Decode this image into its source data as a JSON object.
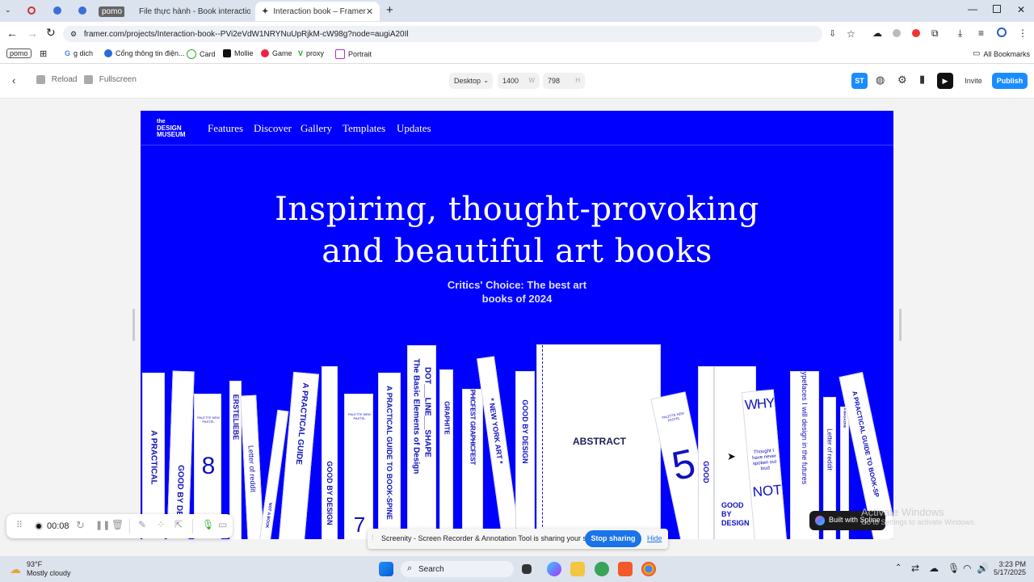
{
  "browser": {
    "tabs": [
      {
        "label": "pomo"
      },
      {
        "label": "File thực hành - Book interactio"
      },
      {
        "label": "Interaction book – Framer"
      }
    ],
    "url": "framer.com/projects/Interaction-book--PVi2eVdW1NRYNuUpRjkM-cW98g?node=augiA20Il",
    "bookmarks": [
      "pomo",
      "g dich",
      "Cổng thông tin điện...",
      "Card",
      "Mollie",
      "Game",
      "proxy",
      "Portrait"
    ],
    "all_bookmarks": "All Bookmarks"
  },
  "framer": {
    "reload": "Reload",
    "fullscreen": "Fullscreen",
    "breakpoint": "Desktop",
    "width": "1400",
    "width_unit": "W",
    "height": "798",
    "height_unit": "H",
    "avatar": "ST",
    "invite": "Invite",
    "publish": "Publish",
    "accent": "#1a8cff"
  },
  "site": {
    "logo": [
      "the",
      "DESIGN",
      "MUSEUM"
    ],
    "nav": [
      "Features",
      "Discover",
      "Gallery",
      "Templates",
      "Updates"
    ],
    "hero_line1": "Inspiring, thought-provoking",
    "hero_line2": "and beautiful art books",
    "sub_line1": "Critics' Choice: The best art",
    "sub_line2": "books of 2024",
    "background": "#0000ff",
    "books": {
      "b1": "A PRACTICAL",
      "b2": "GOOD BY DE",
      "b3_small": "PALETTE NEW PASTEL",
      "b3_num": "8",
      "b4": "ERSTELIEBE",
      "b5": "Letter of reddit",
      "b6": "NOT A BOOK",
      "b7": "A PRACTICAL GUIDE",
      "b8": "GOOD BY DESIGN",
      "b9_small": "PALETTE NEW PASTEL",
      "b9_num": "7",
      "b10": "A PRACTICAL GUIDE TO BOOK-SPINE",
      "b11_a": "DOT___LINE___SHAPE",
      "b11_b": "The Basic Elements of Design",
      "b12": "GRAPHITE",
      "b13": "GRAPHICFEST GRAPHICFEST",
      "b14": "* NEW YORK ART *",
      "b15": "GOOD BY DESIGN",
      "abstract": "ABSTRACT",
      "b17_small": "PALETTE NEW PASTEL",
      "b17_num": "5",
      "b18": "GOOD",
      "b19": "GOOD BY DESIGN",
      "why": "WHY",
      "why_mid": "Thought I have never spoken out loud",
      "not": "NOT",
      "b21": "Typefaces I will design in the futures",
      "b22": "Letter of reddit",
      "b23": "A MAGAZINE",
      "b24": "A PRACTICAL GUIDE TO BOOK-SP"
    }
  },
  "overlays": {
    "timer": "00:08",
    "share_text": "Screenity - Screen Recorder & Annotation Tool is sharing your screen.",
    "stop_sharing": "Stop sharing",
    "hide": "Hide",
    "built_with": "Built with Spline",
    "watermark_title": "Activate Windows",
    "watermark_sub": "Go to Settings to activate Windows."
  },
  "taskbar": {
    "temp": "93°F",
    "weather": "Mostly cloudy",
    "search": "Search",
    "time": "3:23 PM",
    "date": "5/17/2025"
  }
}
